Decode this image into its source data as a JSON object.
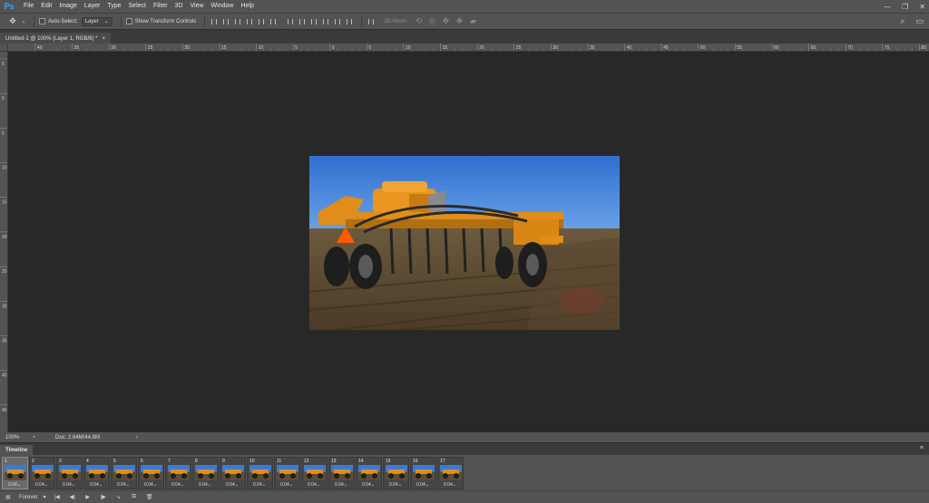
{
  "app": {
    "logo": "Ps"
  },
  "menu": [
    "File",
    "Edit",
    "Image",
    "Layer",
    "Type",
    "Select",
    "Filter",
    "3D",
    "View",
    "Window",
    "Help"
  ],
  "window_controls": {
    "minimize": "—",
    "restore": "❐",
    "close": "✕"
  },
  "options": {
    "auto_select_label": "Auto-Select:",
    "auto_select_value": "Layer",
    "transform_label": "Show Transform Controls",
    "mode_3d_label": "3D Mode:"
  },
  "tab": {
    "title": "Untitled-1 @ 100% (Layer 1, RGB/8) *",
    "close": "×"
  },
  "ruler_top_ticks": [
    "40",
    "35",
    "30",
    "25",
    "20",
    "15",
    "10",
    "5",
    "0",
    "5",
    "10",
    "15",
    "20",
    "25",
    "30",
    "35",
    "40",
    "45",
    "50",
    "55",
    "60",
    "65",
    "70",
    "75",
    "80"
  ],
  "ruler_left_ticks": [
    "5",
    "0",
    "5",
    "10",
    "15",
    "20",
    "25",
    "30",
    "35",
    "40",
    "45"
  ],
  "status": {
    "zoom": "100%",
    "doc": "Doc: 2.64M/44.8M",
    "arrow": "›"
  },
  "timeline": {
    "title": "Timeline",
    "frames": [
      {
        "num": "1",
        "delay": "0.04"
      },
      {
        "num": "2",
        "delay": "0.04"
      },
      {
        "num": "3",
        "delay": "0.04"
      },
      {
        "num": "4",
        "delay": "0.04"
      },
      {
        "num": "5",
        "delay": "0.04"
      },
      {
        "num": "6",
        "delay": "0.04"
      },
      {
        "num": "7",
        "delay": "0.04"
      },
      {
        "num": "8",
        "delay": "0.04"
      },
      {
        "num": "9",
        "delay": "0.04"
      },
      {
        "num": "10",
        "delay": "0.04"
      },
      {
        "num": "11",
        "delay": "0.04"
      },
      {
        "num": "12",
        "delay": "0.04"
      },
      {
        "num": "13",
        "delay": "0.04"
      },
      {
        "num": "14",
        "delay": "0.04"
      },
      {
        "num": "15",
        "delay": "0.04"
      },
      {
        "num": "16",
        "delay": "0.04"
      },
      {
        "num": "17",
        "delay": "0.04"
      }
    ],
    "loop": "Forever"
  }
}
